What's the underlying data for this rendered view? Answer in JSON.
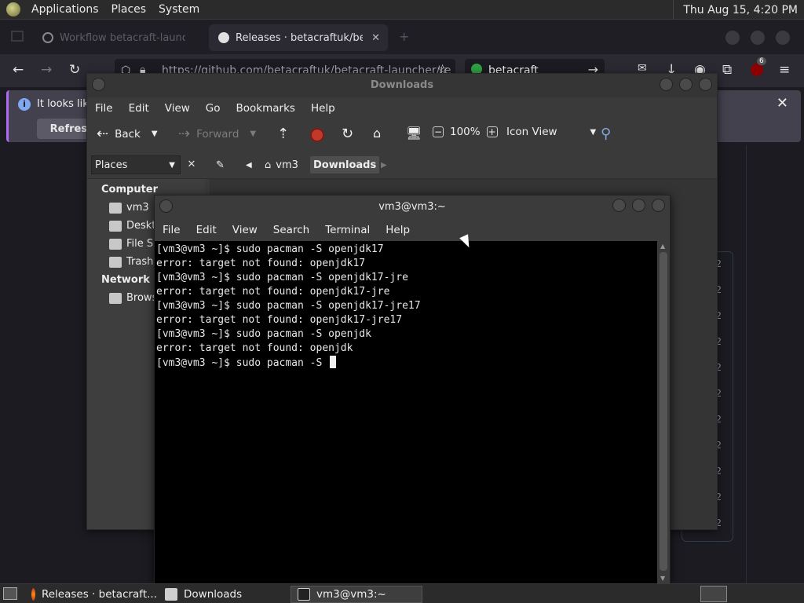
{
  "top_panel": {
    "menus": [
      "Applications",
      "Places",
      "System"
    ],
    "clock": "Thu Aug 15,  4:20 PM"
  },
  "browser": {
    "tab_inactive_title": "Workflow betacraft-launcher - GitHub",
    "tab_active_title": "Releases · betacraftuk/betacraft",
    "url": "https://github.com/betacraftuk/betacraft-launcher/re",
    "search_text": "betacraft",
    "infobar_message": "It looks like",
    "refresh_label": "Refresh",
    "badge_count": "6",
    "side_column_value": "2"
  },
  "file_manager": {
    "title": "Downloads",
    "menus": [
      "File",
      "Edit",
      "View",
      "Go",
      "Bookmarks",
      "Help"
    ],
    "back_label": "Back",
    "forward_label": "Forward",
    "zoom": "100%",
    "view_mode": "Icon View",
    "places_label": "Places",
    "crumbs": [
      "vm3",
      "Downloads"
    ],
    "sidebar": {
      "computer_header": "Computer",
      "computer_items": [
        "vm3",
        "Deskt",
        "File S",
        "Trash"
      ],
      "network_header": "Network",
      "network_items": [
        "Brows"
      ]
    }
  },
  "terminal": {
    "title": "vm3@vm3:~",
    "menus": [
      "File",
      "Edit",
      "View",
      "Search",
      "Terminal",
      "Help"
    ],
    "lines": [
      "[vm3@vm3 ~]$ sudo pacman -S openjdk17",
      "error: target not found: openjdk17",
      "[vm3@vm3 ~]$ sudo pacman -S openjdk17-jre",
      "error: target not found: openjdk17-jre",
      "[vm3@vm3 ~]$ sudo pacman -S openjdk17-jre17",
      "error: target not found: openjdk17-jre17",
      "[vm3@vm3 ~]$ sudo pacman -S openjdk",
      "error: target not found: openjdk"
    ],
    "prompt_line": "[vm3@vm3 ~]$ sudo pacman -S "
  },
  "taskbar": {
    "tasks": [
      "Releases · betacraft...",
      "Downloads",
      "vm3@vm3:~"
    ]
  }
}
